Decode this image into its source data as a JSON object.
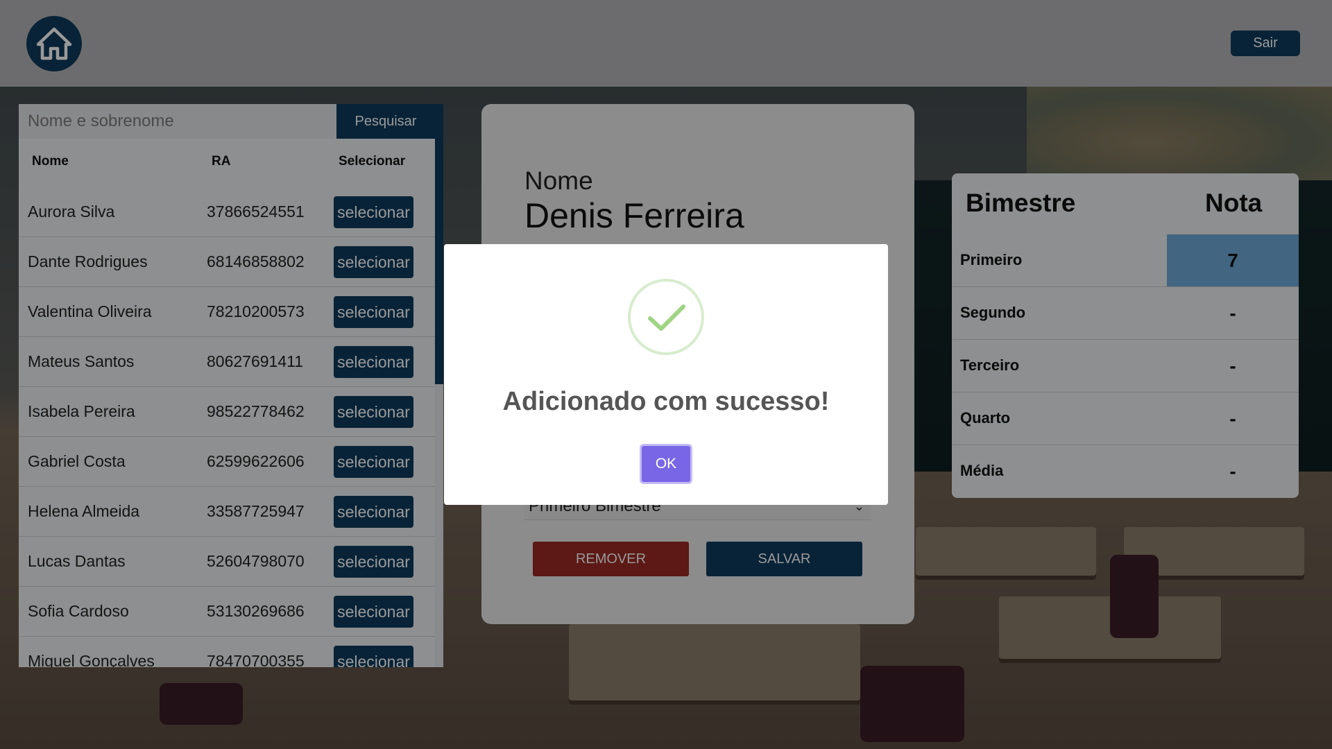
{
  "header": {
    "home_icon": "home-icon",
    "logout_label": "Sair"
  },
  "search": {
    "placeholder": "Nome e sobrenome",
    "button_label": "Pesquisar"
  },
  "student_table": {
    "columns": [
      "Nome",
      "RA",
      "Selecionar"
    ],
    "select_label": "selecionar",
    "rows": [
      {
        "name": "Aurora Silva",
        "ra": "37866524551"
      },
      {
        "name": "Dante Rodrigues",
        "ra": "68146858802"
      },
      {
        "name": "Valentina Oliveira",
        "ra": "78210200573"
      },
      {
        "name": "Mateus Santos",
        "ra": "80627691411"
      },
      {
        "name": "Isabela Pereira",
        "ra": "98522778462"
      },
      {
        "name": "Gabriel Costa",
        "ra": "62599622606"
      },
      {
        "name": "Helena Almeida",
        "ra": "33587725947"
      },
      {
        "name": "Lucas Dantas",
        "ra": "52604798070"
      },
      {
        "name": "Sofia Cardoso",
        "ra": "53130269686"
      },
      {
        "name": "Miguel Gonçalves",
        "ra": "78470700355"
      }
    ]
  },
  "student_form": {
    "name_label": "Nome",
    "name_value": "Denis Ferreira",
    "bimestre_selected": "Primeiro Bimestre",
    "remove_label": "REMOVER",
    "save_label": "SALVAR"
  },
  "grades": {
    "header_period": "Bimestre",
    "header_grade": "Nota",
    "rows": [
      {
        "label": "Primeiro",
        "value": "7"
      },
      {
        "label": "Segundo",
        "value": "-"
      },
      {
        "label": "Terceiro",
        "value": "-"
      },
      {
        "label": "Quarto",
        "value": "-"
      },
      {
        "label": "Média",
        "value": "-"
      }
    ]
  },
  "modal": {
    "icon": "check-icon",
    "message": "Adicionado com sucesso!",
    "ok_label": "OK"
  },
  "colors": {
    "primary": "#0e3b5c",
    "danger": "#9a2b24",
    "highlight": "#6fa8d8",
    "modal_button": "#7966e6"
  }
}
